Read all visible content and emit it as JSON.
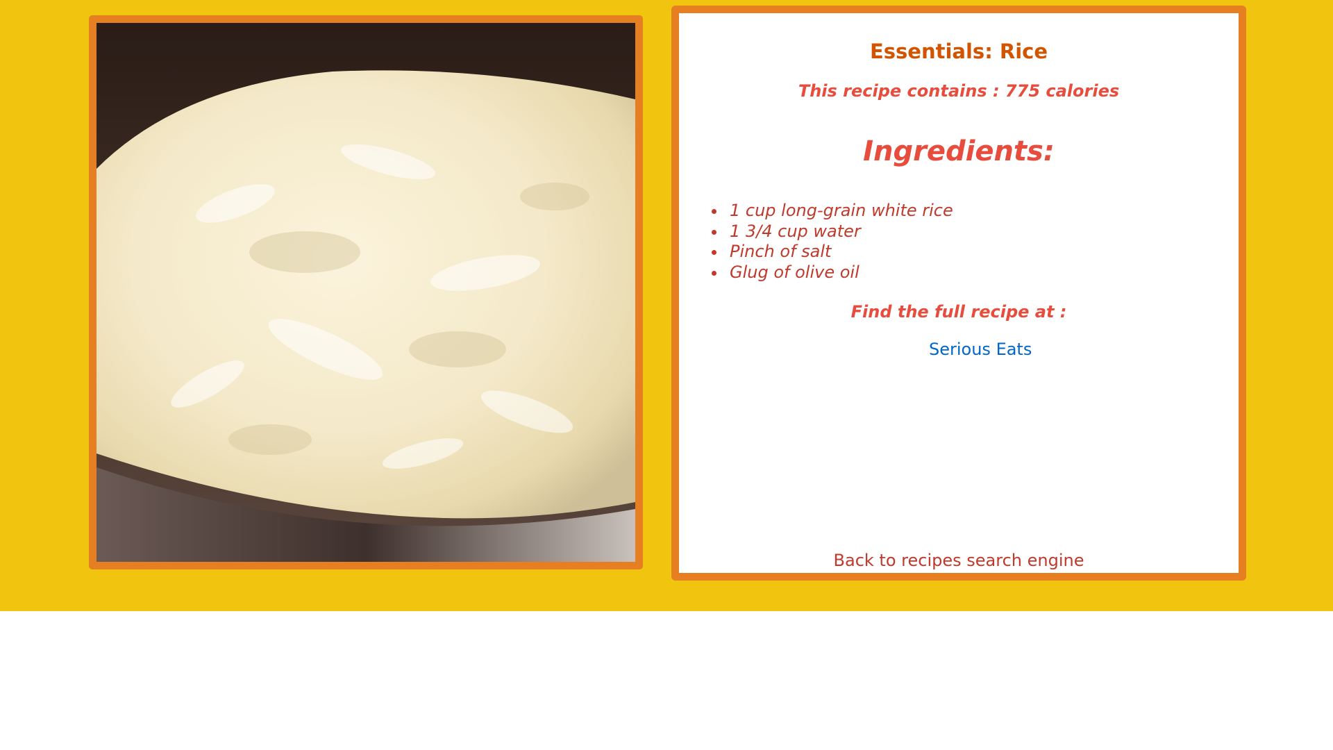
{
  "recipe": {
    "title": "Essentials: Rice",
    "calories_text": "This recipe contains : 775 calories",
    "ingredients_heading": "Ingredients:",
    "ingredients": [
      "1 cup long-grain white rice",
      "1 3/4 cup water",
      "Pinch of salt",
      "Glug of olive oil"
    ],
    "find_label": "Find the full recipe at :",
    "source_link": "Serious Eats",
    "back_link": "Back to recipes search engine"
  },
  "image": {
    "subject": "cooked-white-rice-in-pot"
  },
  "colors": {
    "background": "#f1c40f",
    "frame": "#e67e22",
    "title": "#d35400",
    "accent_red": "#e74c3c",
    "ingredient_text": "#c0392b",
    "link": "#0066cc"
  }
}
